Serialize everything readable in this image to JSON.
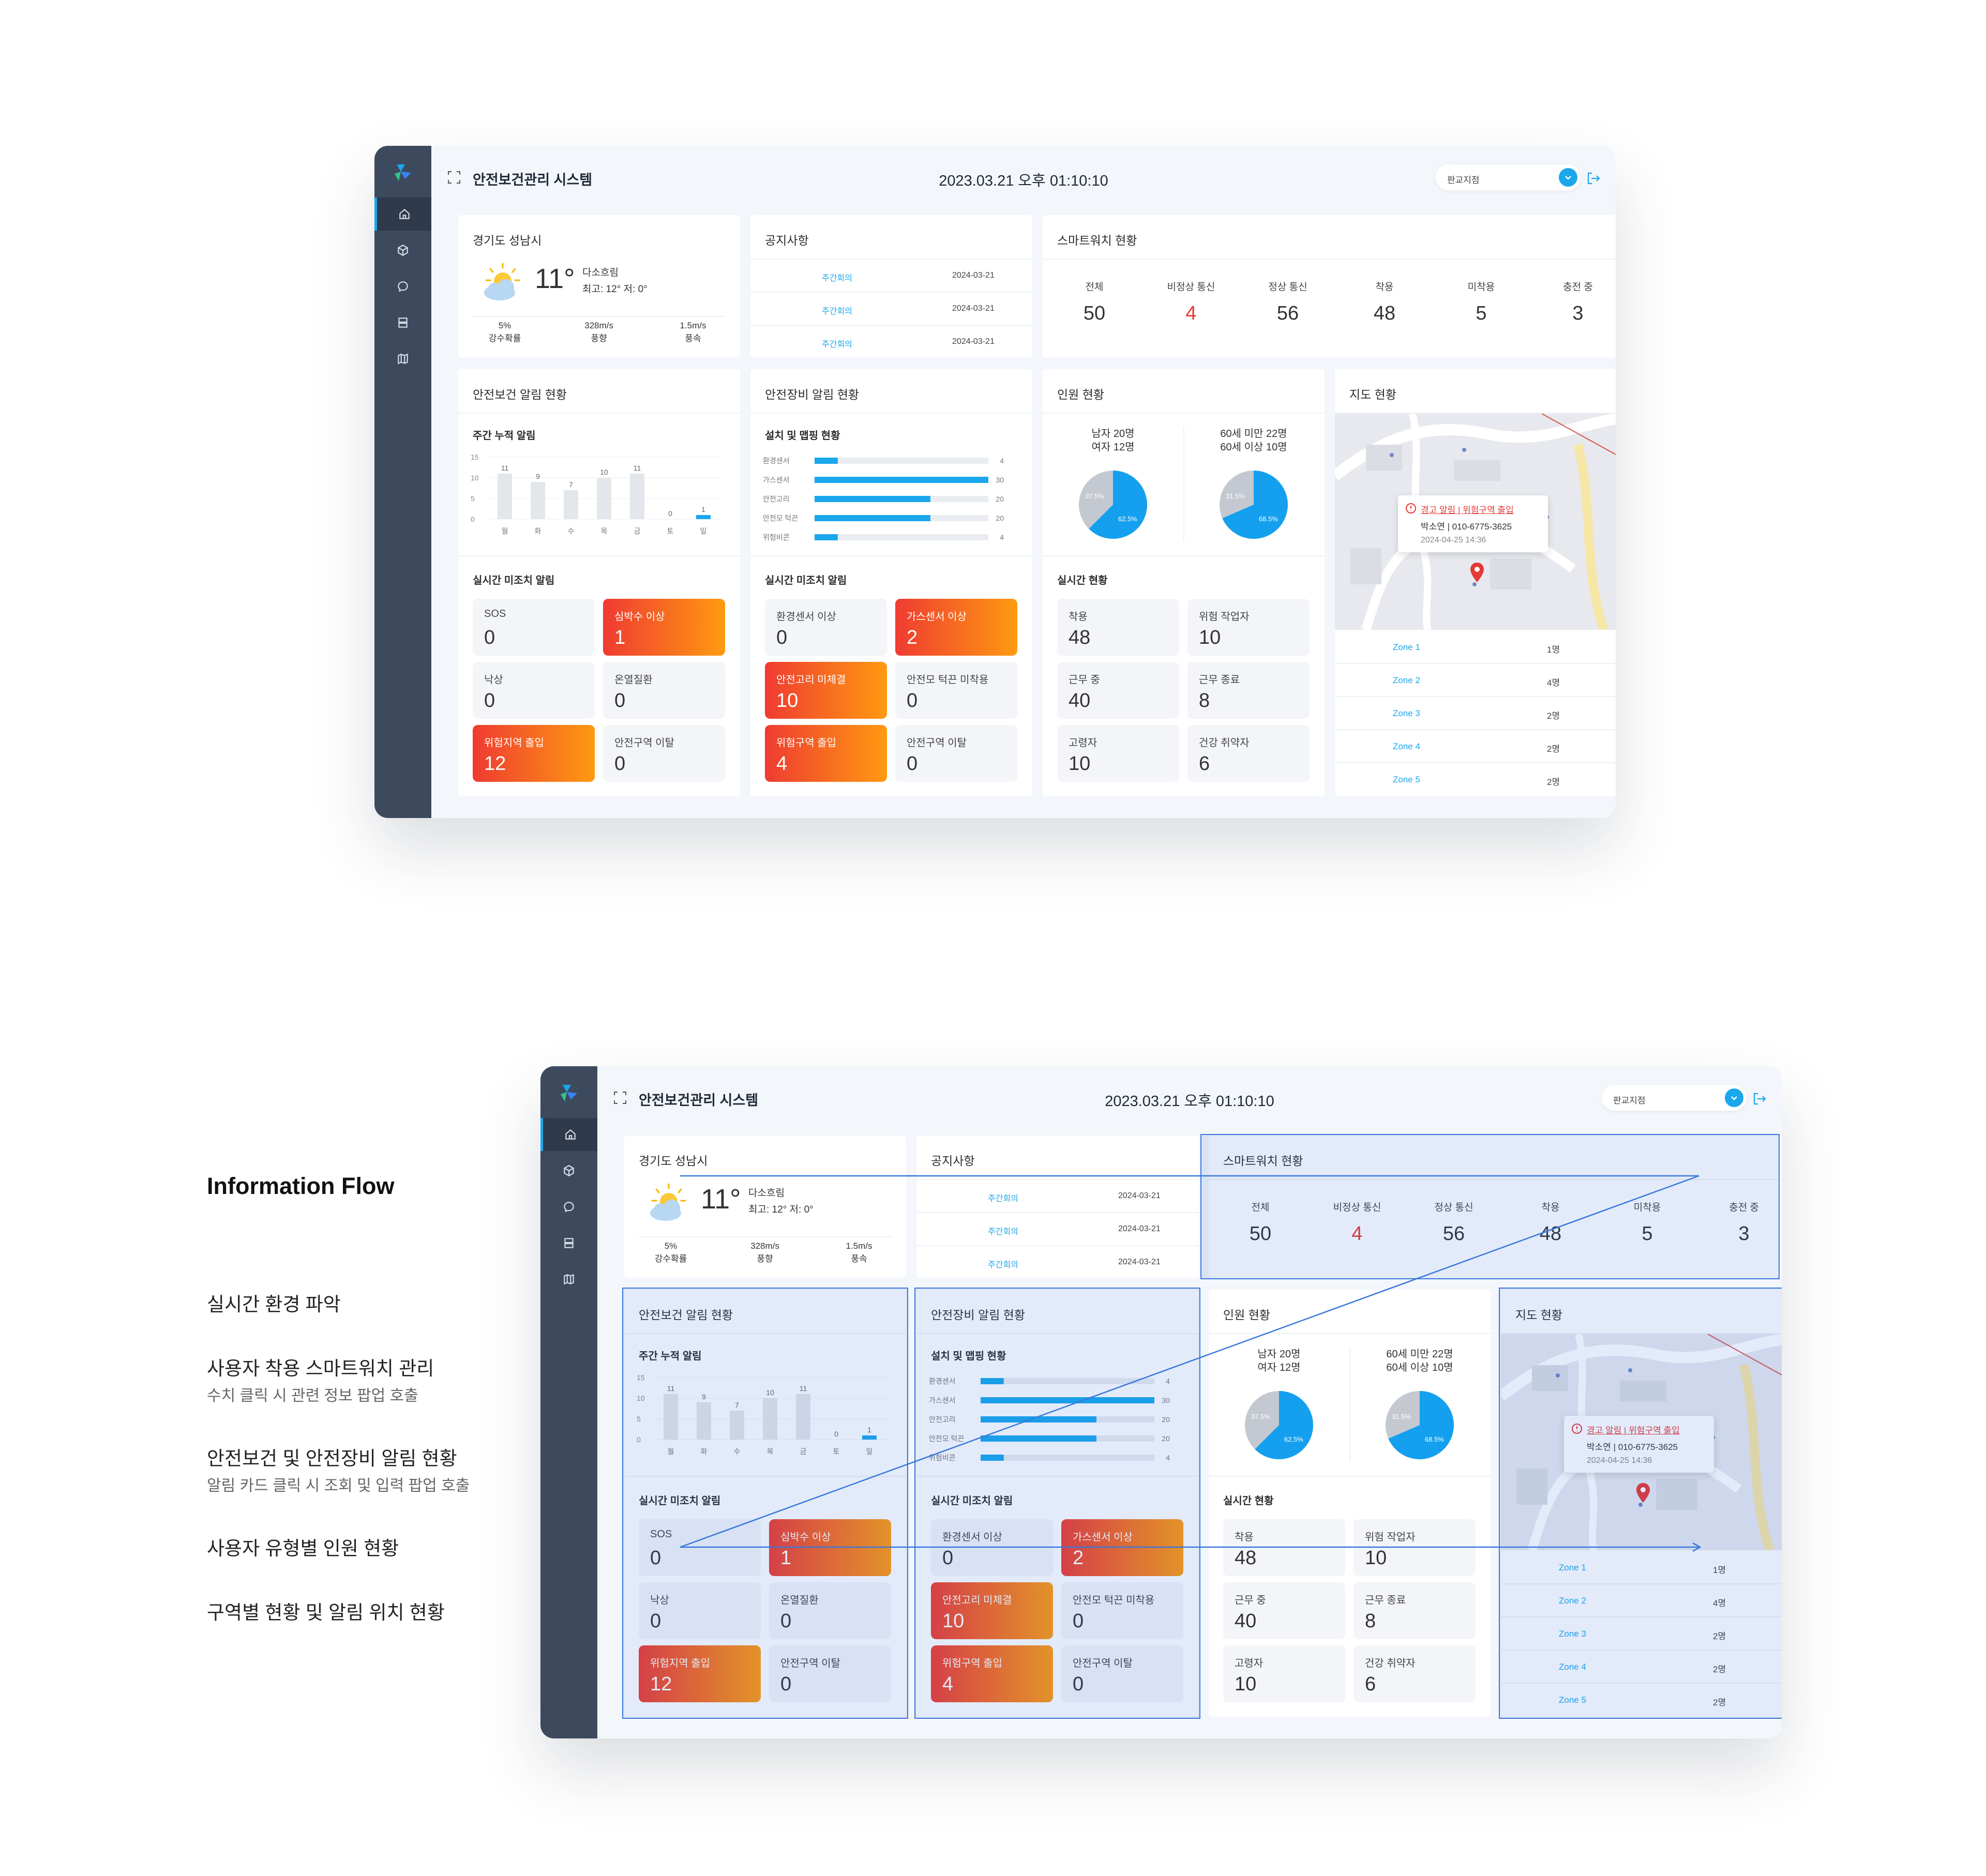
{
  "app": {
    "title": "안전보건관리 시스템",
    "datetime": "2023.03.21 오후 01:10:10",
    "branch": "판교지점"
  },
  "weather": {
    "location": "경기도 성남시",
    "temp": "11°",
    "condition": "다소흐림",
    "range": "최고: 12° 저: 0°",
    "stats": [
      {
        "value": "5%",
        "label": "강수확률"
      },
      {
        "value": "328m/s",
        "label": "풍향"
      },
      {
        "value": "1.5m/s",
        "label": "풍속"
      }
    ]
  },
  "notice": {
    "title": "공지사항",
    "rows": [
      {
        "tag": "주간회의",
        "date": "2024-03-21"
      },
      {
        "tag": "주간회의",
        "date": "2024-03-21"
      },
      {
        "tag": "주간회의",
        "date": "2024-03-21"
      }
    ]
  },
  "smartwatch": {
    "title": "스마트워치 현황",
    "stats": [
      {
        "label": "전체",
        "value": "50"
      },
      {
        "label": "비정상 통신",
        "value": "4"
      },
      {
        "label": "정상 통신",
        "value": "56"
      },
      {
        "label": "착용",
        "value": "48"
      },
      {
        "label": "미착용",
        "value": "5"
      },
      {
        "label": "충전 중",
        "value": "3"
      }
    ]
  },
  "safety_alert": {
    "title": "안전보건 알림 현황",
    "weekly_title": "주간 누적 알림",
    "realtime_title": "실시간 미조치 알림",
    "tiles": [
      {
        "label": "SOS",
        "value": "0",
        "alert": false
      },
      {
        "label": "심박수 이상",
        "value": "1",
        "alert": true
      },
      {
        "label": "낙상",
        "value": "0",
        "alert": false
      },
      {
        "label": "온열질환",
        "value": "0",
        "alert": false
      },
      {
        "label": "위험지역 출입",
        "value": "12",
        "alert": true
      },
      {
        "label": "안전구역 이탈",
        "value": "0",
        "alert": false
      }
    ]
  },
  "equipment_alert": {
    "title": "안전장비 알림 현황",
    "install_title": "설치 및 맵핑 현황",
    "realtime_title": "실시간 미조치 알림",
    "tiles": [
      {
        "label": "환경센서 이상",
        "value": "0",
        "alert": false
      },
      {
        "label": "가스센서 이상",
        "value": "2",
        "alert": true
      },
      {
        "label": "안전고리 미체결",
        "value": "10",
        "alert": true
      },
      {
        "label": "안전모 턱끈 미착용",
        "value": "0",
        "alert": false
      },
      {
        "label": "위험구역 출입",
        "value": "4",
        "alert": true
      },
      {
        "label": "안전구역 이탈",
        "value": "0",
        "alert": false
      }
    ]
  },
  "personnel": {
    "title": "인원 현황",
    "gender": {
      "line1": "남자 20명",
      "line2": "여자 12명",
      "small_pct": "37.5%",
      "large_pct": "62.5%",
      "share": 0.625
    },
    "age": {
      "line1": "60세 미만 22명",
      "line2": "60세 이상 10명",
      "small_pct": "31.5%",
      "large_pct": "68.5%",
      "share": 0.685
    },
    "realtime_title": "실시간 현황",
    "tiles": [
      {
        "label": "착용",
        "value": "48"
      },
      {
        "label": "위험 작업자",
        "value": "10"
      },
      {
        "label": "근무 중",
        "value": "40"
      },
      {
        "label": "근무 종료",
        "value": "8"
      },
      {
        "label": "고령자",
        "value": "10"
      },
      {
        "label": "건강 취약자",
        "value": "6"
      }
    ]
  },
  "map": {
    "title": "지도 현황",
    "popup": {
      "alert": "경고 알림 | 위험구역 출입",
      "person": "박소연 | 010-6775-3625",
      "time": "2024-04-25 14:36"
    },
    "zones": [
      {
        "name": "Zone 1",
        "count": "1명"
      },
      {
        "name": "Zone 2",
        "count": "4명"
      },
      {
        "name": "Zone 3",
        "count": "2명"
      },
      {
        "name": "Zone 4",
        "count": "2명"
      },
      {
        "name": "Zone 5",
        "count": "2명"
      }
    ]
  },
  "chart_data": [
    {
      "type": "bar",
      "title": "주간 누적 알림",
      "categories": [
        "월",
        "화",
        "수",
        "목",
        "금",
        "토",
        "일"
      ],
      "values": [
        11,
        9,
        7,
        10,
        11,
        0,
        1
      ],
      "highlight_index": 6,
      "ylim": [
        0,
        15
      ],
      "yticks": [
        0,
        5,
        10,
        15
      ]
    },
    {
      "type": "bar",
      "title": "설치 및 맵핑 현황",
      "orientation": "horizontal",
      "categories": [
        "환경센서",
        "가스센서",
        "안전고리",
        "안전모 턱끈",
        "위험비콘"
      ],
      "values": [
        4,
        30,
        20,
        20,
        4
      ],
      "xlim": [
        0,
        30
      ]
    }
  ],
  "flow": {
    "title": "Information Flow",
    "items": [
      {
        "title": "실시간 환경 파악",
        "desc": ""
      },
      {
        "title": "사용자 착용 스마트워치 관리",
        "desc": "수치 클릭 시 관련 정보 팝업 호출"
      },
      {
        "title": "안전보건 및 안전장비 알림 현황",
        "desc": "알림 카드 클릭 시 조회 및 입력 팝업 호출"
      },
      {
        "title": "사용자 유형별 인원 현황",
        "desc": ""
      },
      {
        "title": "구역별 현황 및 알림 위치 현황",
        "desc": ""
      }
    ]
  },
  "colors": {
    "accent": "#1aa7ec",
    "sidebar": "#3d4a5e",
    "alert_start": "#ef3b32",
    "alert_end": "#ff9a10",
    "danger_text": "#e53935",
    "highlight": "#3a78dc"
  }
}
